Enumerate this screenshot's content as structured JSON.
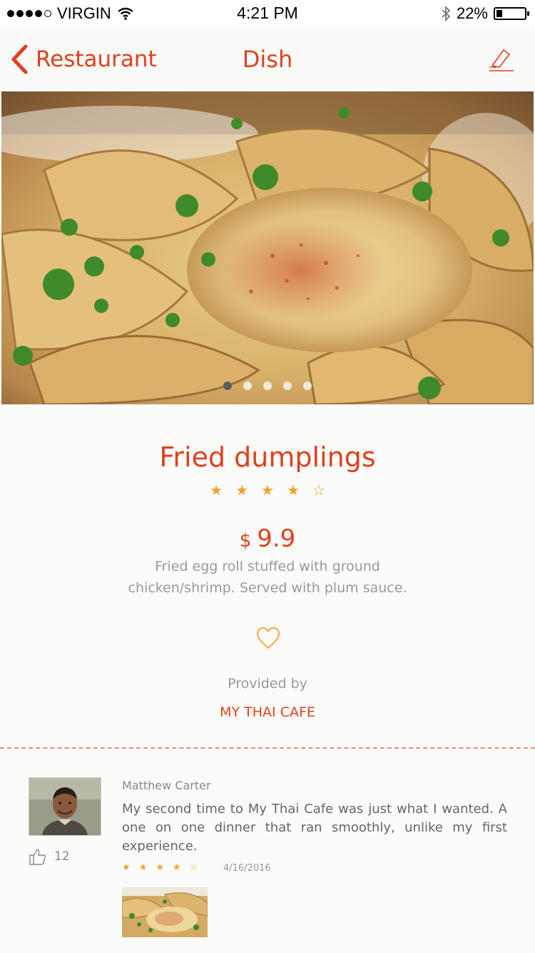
{
  "status_bar": {
    "carrier": "VIRGIN",
    "time": "4:21 PM",
    "battery": "22%",
    "battery_level": 0.22,
    "icons": [
      "signal-dots-icon",
      "wifi-icon",
      "bluetooth-icon",
      "battery-icon"
    ]
  },
  "nav": {
    "back_label": "Restaurant",
    "title": "Dish",
    "back_icon": "chevron-left-icon",
    "edit_icon": "edit-icon"
  },
  "gallery": {
    "image_count": 5,
    "active_index": 0
  },
  "dish": {
    "name": "Fried dumplings",
    "rating": 4,
    "rating_max": 5,
    "currency": "$",
    "price": "9.9",
    "description": "Fried egg roll stuffed with ground chicken/shrimp. Served with plum sauce.",
    "favorite_icon": "heart-outline-icon",
    "provided_by_label": "Provided by",
    "restaurant": "MY THAI CAFE"
  },
  "review": {
    "reviewer": "Matthew Carter",
    "likes": "12",
    "like_icon": "thumbs-up-icon",
    "text": "My second time to My Thai Cafe was just what I wanted. A one on one dinner that ran smoothly, unlike my first experience.",
    "rating": 4,
    "rating_max": 5,
    "date": "4/16/2016"
  },
  "colors": {
    "accent": "#e0411c",
    "star": "#f2a12b",
    "muted_text": "#999999",
    "divider": "#ee8b74"
  }
}
